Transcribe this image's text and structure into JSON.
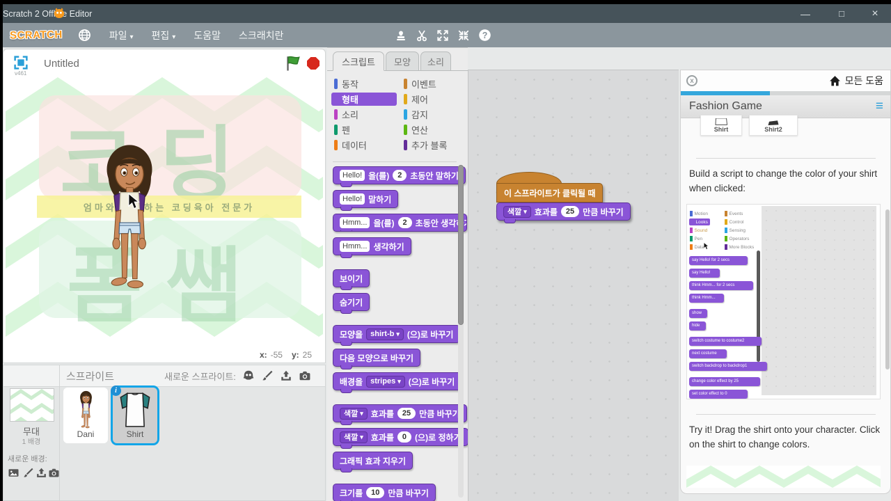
{
  "window": {
    "title": "Scratch 2 Offline Editor",
    "controls": {
      "minimize": "—",
      "maximize": "□",
      "close": "×"
    }
  },
  "menubar": {
    "logo": "SCRATCH",
    "file": "파일",
    "edit": "편집",
    "help": "도움말",
    "about": "스크래치란"
  },
  "stage": {
    "title": "Untitled",
    "version": "v461",
    "banner_text": "엄마와 함께하는 코딩육아 전문가",
    "watermark_top": "코딩",
    "watermark_bottom": "폼쌤",
    "coord": {
      "x_label": "x:",
      "x_value": "-55",
      "y_label": "y:",
      "y_value": "25"
    }
  },
  "sprites": {
    "header": "스프라이트",
    "new_sprite_label": "새로운 스프라이트:",
    "stage_name": "무대",
    "backdrop_count": "1 배경",
    "new_backdrop_label": "새로운 배경:",
    "info_badge": "i",
    "items": [
      {
        "name": "Dani"
      },
      {
        "name": "Shirt"
      }
    ]
  },
  "palette": {
    "tabs": [
      {
        "label": "스크립트"
      },
      {
        "label": "모양"
      },
      {
        "label": "소리"
      }
    ],
    "categories": [
      {
        "label": "동작",
        "color": "#4a6cd4"
      },
      {
        "label": "이벤트",
        "color": "#c88330"
      },
      {
        "label": "형태",
        "color": "#8a55d7"
      },
      {
        "label": "제어",
        "color": "#e1a91a"
      },
      {
        "label": "소리",
        "color": "#bb42c3"
      },
      {
        "label": "감지",
        "color": "#2ca5e2"
      },
      {
        "label": "펜",
        "color": "#0e9a6c"
      },
      {
        "label": "연산",
        "color": "#5cb712"
      },
      {
        "label": "데이터",
        "color": "#ee7d16"
      },
      {
        "label": "추가 블록",
        "color": "#632d99"
      }
    ],
    "blocks": {
      "say_secs": {
        "input": "Hello!",
        "t1": "을(를)",
        "num": "2",
        "t2": "초동안 말하기"
      },
      "say": {
        "input": "Hello!",
        "t1": "말하기"
      },
      "think_secs": {
        "input": "Hmm...",
        "t1": "을(를)",
        "num": "2",
        "t2": "초동안 생각하기"
      },
      "think": {
        "input": "Hmm...",
        "t1": "생각하기"
      },
      "show": {
        "t1": "보이기"
      },
      "hide": {
        "t1": "숨기기"
      },
      "switch_costume": {
        "t1": "모양을",
        "dd": "shirt-b",
        "t2": "(으)로 바꾸기"
      },
      "next_costume": {
        "t1": "다음 모양으로 바꾸기"
      },
      "switch_backdrop": {
        "t1": "배경을",
        "dd": "stripes",
        "t2": "(으)로 바꾸기"
      },
      "change_effect": {
        "dd": "색깔",
        "t1": "효과를",
        "num": "25",
        "t2": "만큼 바꾸기"
      },
      "set_effect": {
        "dd": "색깔",
        "t1": "효과를",
        "num": "0",
        "t2": "(으)로 정하기"
      },
      "clear_effects": {
        "t1": "그래픽 효과 지우기"
      },
      "change_size": {
        "t1": "크기를",
        "num": "10",
        "t2": "만큼 바꾸기"
      }
    }
  },
  "script": {
    "hat": "이 스프라이트가 클릭될 때",
    "change_effect": {
      "dd": "색깔",
      "t1": "효과를",
      "num": "25",
      "t2": "만큼 바꾸기"
    }
  },
  "tips": {
    "close": "x",
    "home_label": "모든 도움",
    "title": "Fashion Game",
    "menu_icon": "≡",
    "thumbs": [
      {
        "label": "Shirt"
      },
      {
        "label": "Shirt2"
      }
    ],
    "build_text": "Build a script to change the color of your shirt when clicked:",
    "try_text": "Try it! Drag the shirt onto your character. Click on the shirt to change colors.",
    "mini_categories": [
      {
        "label": "Motion",
        "color": "#4a6cd4"
      },
      {
        "label": "Events",
        "color": "#c88330"
      },
      {
        "label": "Looks",
        "color": "#8a55d7"
      },
      {
        "label": "Control",
        "color": "#e1a91a"
      },
      {
        "label": "Sound",
        "color": "#bb42c3"
      },
      {
        "label": "Sensing",
        "color": "#2ca5e2"
      },
      {
        "label": "Pen",
        "color": "#0e9a6c"
      },
      {
        "label": "Operators",
        "color": "#5cb712"
      },
      {
        "label": "Data",
        "color": "#ee7d16"
      },
      {
        "label": "More Blocks",
        "color": "#632d99"
      }
    ],
    "mini_blocks": [
      {
        "label": "say Hello! for 2 secs"
      },
      {
        "label": "say Hello!"
      },
      {
        "label": "think Hmm... for 2 secs"
      },
      {
        "label": "think Hmm..."
      },
      {
        "label": "show"
      },
      {
        "label": "hide"
      },
      {
        "label": "switch costume to costume2"
      },
      {
        "label": "next costume"
      },
      {
        "label": "switch backdrop to backdrop1"
      },
      {
        "label": "change color effect by 25"
      },
      {
        "label": "set color effect to 0"
      }
    ]
  },
  "colors": {
    "accent_blue": "#35a7dc",
    "looks_purple": "#8a55d7",
    "events_orange": "#c88330"
  }
}
